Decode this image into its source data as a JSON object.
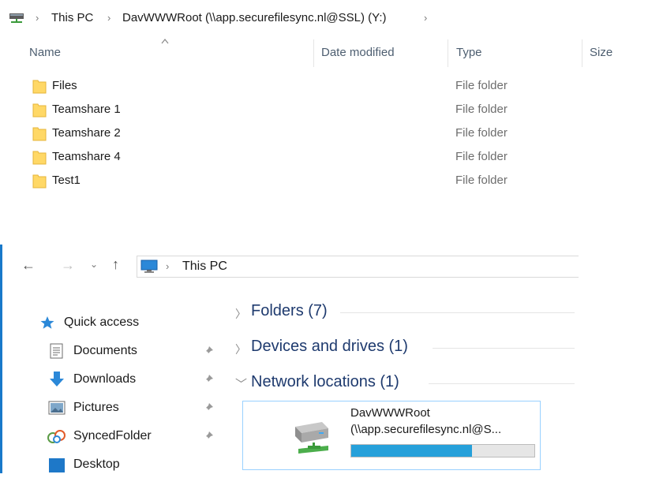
{
  "top": {
    "breadcrumb": [
      "This PC",
      "DavWWWRoot (\\\\app.securefilesync.nl@SSL) (Y:)"
    ],
    "columns": {
      "name": "Name",
      "date_modified": "Date modified",
      "type": "Type",
      "size": "Size"
    },
    "files": [
      {
        "name": "Files",
        "type": "File folder"
      },
      {
        "name": "Teamshare 1",
        "type": "File folder"
      },
      {
        "name": "Teamshare 2",
        "type": "File folder"
      },
      {
        "name": "Teamshare 4",
        "type": "File folder"
      },
      {
        "name": "Test1",
        "type": "File folder"
      }
    ]
  },
  "bottom": {
    "address": {
      "location": "This PC"
    },
    "nav": {
      "quick_access": "Quick access",
      "items": [
        {
          "label": "Documents",
          "icon": "documents-icon",
          "pinned": true
        },
        {
          "label": "Downloads",
          "icon": "downloads-icon",
          "pinned": true
        },
        {
          "label": "Pictures",
          "icon": "pictures-icon",
          "pinned": true
        },
        {
          "label": "SyncedFolder",
          "icon": "synced-folder-icon",
          "pinned": true
        },
        {
          "label": "Desktop",
          "icon": "desktop-icon",
          "pinned": false
        }
      ]
    },
    "sections": [
      {
        "title": "Folders (7)",
        "expanded": false
      },
      {
        "title": "Devices and drives (1)",
        "expanded": false
      },
      {
        "title": "Network locations (1)",
        "expanded": true
      }
    ],
    "network_drive": {
      "name": "DavWWWRoot",
      "path": "(\\\\app.securefilesync.nl@S...",
      "used_fraction": 0.66
    }
  },
  "colors": {
    "accent": "#1979ca",
    "capacity": "#26a0da",
    "section_title": "#1e3a6e",
    "folder": "#ffd866"
  }
}
